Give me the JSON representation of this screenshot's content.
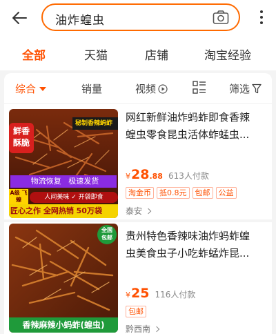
{
  "search": {
    "query": "油炸蝗虫"
  },
  "icons": {
    "back": "back-arrow-icon",
    "camera": "camera-icon",
    "more": "more-vertical-icon",
    "play": "play-icon",
    "layout": "list-layout-icon",
    "filter": "filter-icon"
  },
  "tabs": [
    "全部",
    "天猫",
    "店铺",
    "淘宝经验"
  ],
  "sort": {
    "comprehensive": "综合",
    "sales": "销量",
    "video": "视频",
    "filter": "筛选"
  },
  "colors": {
    "accent": "#ff5000",
    "search_border": "#ff6a00"
  },
  "products": [
    {
      "title_line1": "网红新鲜油炸蚂蚱即食香辣",
      "title_line2": "蝗虫零食昆虫活体蚱蜢虫...",
      "currency": "¥",
      "price_int": "28",
      "price_dec": ".88",
      "sold": "613人付款",
      "tags": [
        "淘金币",
        "抵0.8元",
        "包邮",
        "公益"
      ],
      "shop": "泰安",
      "image": {
        "badge": "鲜香 酥脆",
        "banner": "秘制香辣蚂蚱",
        "strip": "物流恢复   极速发货",
        "side_badge": "A级 飞蝗",
        "chips": "人间美味 ✓ 开袋即食",
        "footer": "匠心之作 全网热销 50万袋"
      }
    },
    {
      "title_line1": "贵州特色香辣味油炸蚂蚱蝗",
      "title_line2": "虫美食虫子小吃蚱蜢炸昆...",
      "currency": "¥",
      "price_int": "25",
      "price_dec": "",
      "sold": "116人付款",
      "tags": [
        "包邮"
      ],
      "shop": "黔西南",
      "image": {
        "corner_badge": "全国 包邮",
        "footer": "香辣麻辣小蚂蚱(蝗虫)"
      }
    }
  ]
}
